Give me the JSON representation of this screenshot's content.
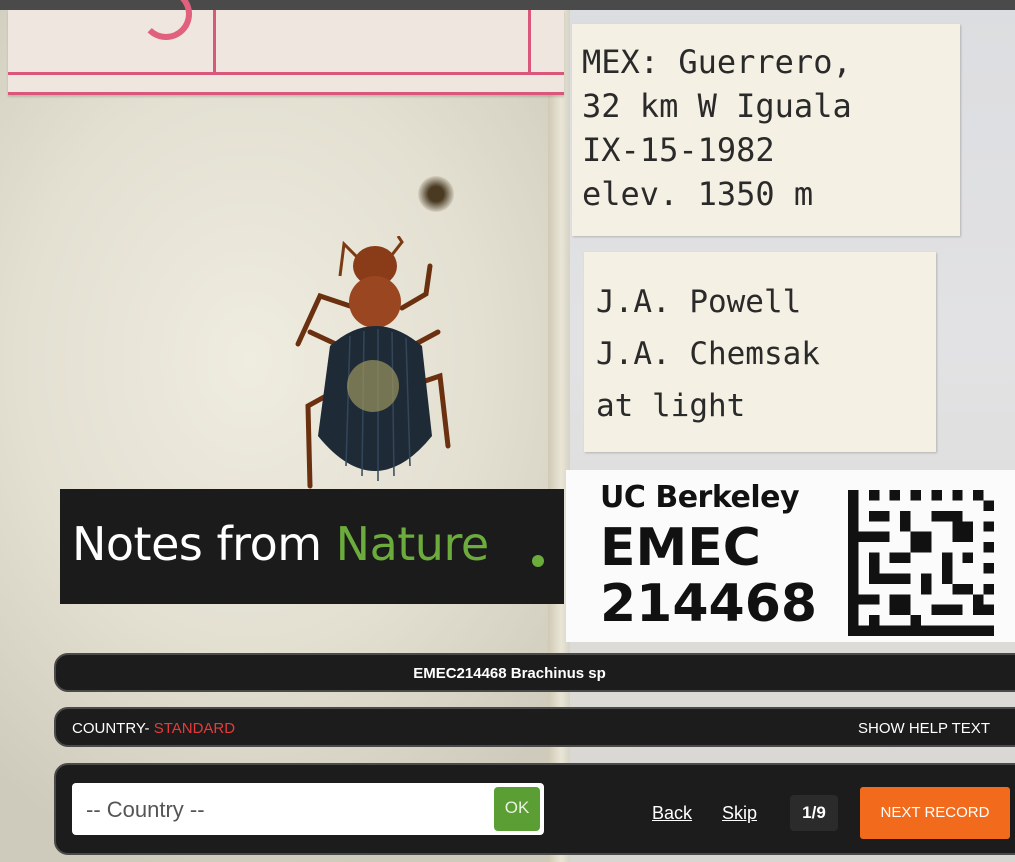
{
  "photo": {
    "locality_label": [
      "MEX: Guerrero,",
      "32 km W Iguala",
      "IX-15-1982",
      "elev. 1350 m"
    ],
    "collector_label": [
      "J.A. Powell",
      "J.A. Chemsak",
      "at light"
    ],
    "barcode_label": {
      "institution": "UC Berkeley",
      "collection": "EMEC",
      "number": "214468"
    }
  },
  "brand": {
    "name_part1": "Notes from ",
    "name_part2": "Nature",
    "accent_color": "#6cac3c"
  },
  "record": {
    "title": "EMEC214468 Brachinus sp"
  },
  "field": {
    "label": "COUNTRY- ",
    "status": "STANDARD",
    "help_label": "SHOW HELP TEXT"
  },
  "form": {
    "country_placeholder": "-- Country --",
    "ok_label": "OK",
    "back_label": "Back",
    "skip_label": "Skip",
    "progress": "1/9",
    "next_label": "NEXT RECORD"
  },
  "colors": {
    "next_button": "#f26a1b",
    "ok_button": "#5a9e34",
    "status_text": "#e53b3b"
  }
}
